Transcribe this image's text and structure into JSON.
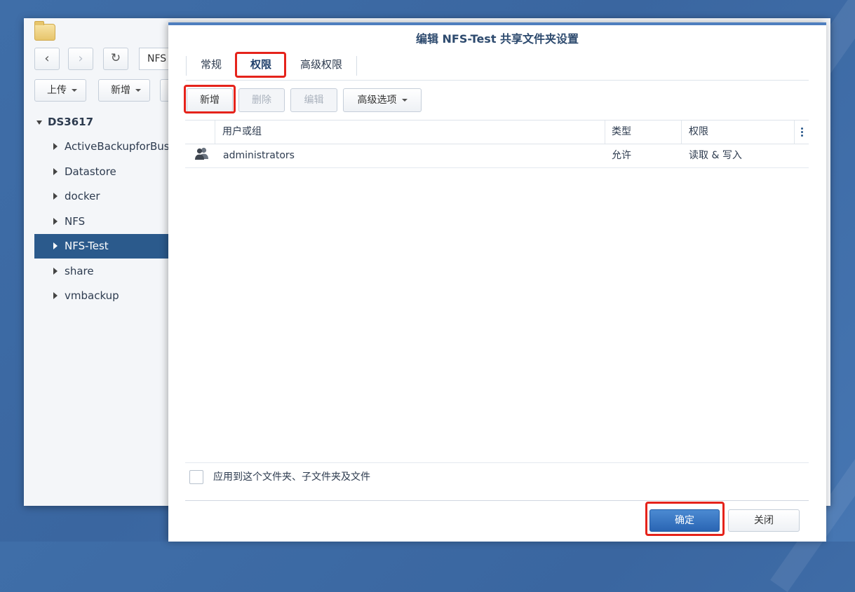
{
  "file_station": {
    "path_text": "NFS",
    "toolbar": {
      "upload_label": "上传",
      "create_label": "新增"
    },
    "tree_root": "DS3617",
    "tree_items": [
      {
        "label": "ActiveBackupforBusiness"
      },
      {
        "label": "Datastore"
      },
      {
        "label": "docker"
      },
      {
        "label": "NFS"
      },
      {
        "label": "NFS-Test",
        "selected": true
      },
      {
        "label": "share"
      },
      {
        "label": "vmbackup"
      }
    ]
  },
  "dialog": {
    "title": "编辑 NFS-Test 共享文件夹设置",
    "tabs": [
      {
        "label": "常规"
      },
      {
        "label": "权限",
        "active": true
      },
      {
        "label": "高级权限"
      }
    ],
    "toolbar": {
      "create_label": "新增",
      "delete_label": "删除",
      "edit_label": "编辑",
      "advanced_label": "高级选项"
    },
    "grid": {
      "columns": [
        "用户或组",
        "类型",
        "权限"
      ],
      "rows": [
        {
          "icon": "user-group-icon",
          "name": "administrators",
          "type": "允许",
          "permission": "读取 & 写入"
        }
      ]
    },
    "apply_label": "应用到这个文件夹、子文件夹及文件",
    "ok_label": "确定",
    "close_label": "关闭"
  },
  "colors": {
    "desktop": "#3f6ea8",
    "selected_tree": "#2b5a8c",
    "primary_button": "#2a65b3",
    "highlight": "#e5231b"
  }
}
